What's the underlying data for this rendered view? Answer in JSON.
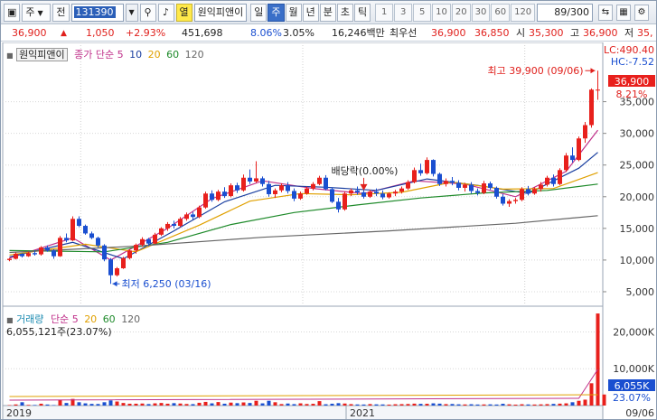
{
  "toolbar": {
    "market": "주",
    "prefix": "전",
    "code": "131390",
    "period_active": "주",
    "periods": [
      "일",
      "주",
      "월",
      "년",
      "분",
      "초",
      "틱"
    ],
    "intervals": [
      "1",
      "3",
      "5",
      "10",
      "20",
      "30",
      "60",
      "120"
    ],
    "stock_name": "원익피앤이",
    "tag": "열",
    "count": "89/300"
  },
  "quote": {
    "price": "36,900",
    "change": "1,050",
    "change_pct": "+2.93%",
    "volume": "451,698",
    "vol_rate": "8.06%",
    "turnover": "3.05%",
    "amount": "16,246백만",
    "best_label": "최우선",
    "best_ask": "36,900",
    "best_bid": "36,850",
    "open_label": "시",
    "open": "35,300",
    "high_label": "고",
    "high": "36,900",
    "low_label": "저",
    "low": "35,"
  },
  "price_legend": {
    "name": "원익피앤이",
    "ma_label": "종가 단순",
    "periods": [
      "5",
      "10",
      "20",
      "60",
      "120"
    ],
    "colors": [
      "#c0308a",
      "#1a3fa0",
      "#e0a000",
      "#1e8a2a",
      "#666666"
    ]
  },
  "volume_legend": {
    "name": "거래량",
    "ma_label": "단순",
    "periods": [
      "5",
      "20",
      "60",
      "120"
    ],
    "info": "6,055,121주(23.07%)"
  },
  "annotations": {
    "high": "최고 39,900 (09/06)",
    "low": "최저 6,250 (03/16)",
    "dividend": "배당락(0.00%)",
    "lc": "LC:490.40",
    "hc": "HC:-7.52",
    "last_price": "36,900",
    "last_pct": "8.21%",
    "last_vol": "6,055K",
    "last_vol_pct": "23.07%"
  },
  "x_axis": [
    "2019",
    "2021",
    "09/06"
  ],
  "chart_data": {
    "type": "candlestick",
    "price_axis": {
      "ticks": [
        5000,
        10000,
        15000,
        20000,
        25000,
        30000,
        35000
      ],
      "labels": [
        "5,000",
        "10,000",
        "15,000",
        "20,000",
        "25,000",
        "30,000",
        "35,000"
      ],
      "ylim": [
        3000,
        41500
      ]
    },
    "volume_axis": {
      "ticks": [
        10000,
        20000
      ],
      "labels": [
        "10,000K",
        "20,000K"
      ],
      "ylim": [
        0,
        26000
      ]
    },
    "candles": [
      [
        0,
        10000,
        10300,
        9800,
        10200
      ],
      [
        1,
        10200,
        11200,
        10100,
        11000
      ],
      [
        2,
        11000,
        11100,
        10400,
        10600
      ],
      [
        3,
        10600,
        11300,
        10500,
        11100
      ],
      [
        4,
        11100,
        11500,
        10700,
        10900
      ],
      [
        5,
        10900,
        12200,
        10700,
        12000
      ],
      [
        6,
        12000,
        12300,
        11300,
        11500
      ],
      [
        7,
        11500,
        11700,
        10200,
        10600
      ],
      [
        8,
        10600,
        13800,
        10500,
        13500
      ],
      [
        9,
        13500,
        14200,
        12800,
        13100
      ],
      [
        10,
        13100,
        16900,
        13000,
        16500
      ],
      [
        11,
        16500,
        16900,
        15200,
        15400
      ],
      [
        12,
        15400,
        15600,
        14000,
        14200
      ],
      [
        13,
        14200,
        14500,
        13300,
        13500
      ],
      [
        14,
        13500,
        13700,
        12000,
        12300
      ],
      [
        15,
        12300,
        12500,
        9800,
        10100
      ],
      [
        16,
        10100,
        10300,
        6250,
        7600
      ],
      [
        17,
        7600,
        8900,
        7400,
        8700
      ],
      [
        18,
        8700,
        10500,
        8600,
        10300
      ],
      [
        19,
        10300,
        11700,
        10100,
        11500
      ],
      [
        20,
        11500,
        12600,
        11000,
        12400
      ],
      [
        21,
        12400,
        13600,
        12100,
        13300
      ],
      [
        22,
        13300,
        13500,
        12200,
        12600
      ],
      [
        23,
        12600,
        14300,
        12500,
        14000
      ],
      [
        24,
        14000,
        15200,
        13800,
        15000
      ],
      [
        25,
        15000,
        16000,
        14600,
        15700
      ],
      [
        26,
        15700,
        16200,
        15000,
        15400
      ],
      [
        27,
        15400,
        16800,
        15200,
        16500
      ],
      [
        28,
        16500,
        17500,
        16200,
        17200
      ],
      [
        29,
        17200,
        17600,
        16400,
        16800
      ],
      [
        30,
        16800,
        18600,
        16600,
        18300
      ],
      [
        31,
        18300,
        20800,
        18100,
        20500
      ],
      [
        32,
        20500,
        21000,
        19200,
        19500
      ],
      [
        33,
        19500,
        21100,
        19300,
        20800
      ],
      [
        34,
        20800,
        21500,
        19800,
        20100
      ],
      [
        35,
        20100,
        22100,
        19900,
        21800
      ],
      [
        36,
        21800,
        22200,
        20600,
        21000
      ],
      [
        37,
        21000,
        23500,
        20800,
        23000
      ],
      [
        38,
        23000,
        24300,
        22000,
        22400
      ],
      [
        39,
        22400,
        25600,
        22200,
        22900
      ],
      [
        40,
        22900,
        23200,
        21600,
        22000
      ],
      [
        41,
        22000,
        22500,
        20000,
        20400
      ],
      [
        42,
        20400,
        21300,
        19800,
        21000
      ],
      [
        43,
        21000,
        22100,
        20700,
        21800
      ],
      [
        44,
        21800,
        22300,
        20500,
        20900
      ],
      [
        45,
        20900,
        21300,
        19300,
        19700
      ],
      [
        46,
        19700,
        20800,
        19500,
        20500
      ],
      [
        47,
        20500,
        21600,
        20300,
        21300
      ],
      [
        48,
        21300,
        22300,
        21000,
        22000
      ],
      [
        49,
        22000,
        23300,
        21800,
        23000
      ],
      [
        50,
        23000,
        23400,
        21000,
        21200
      ],
      [
        51,
        21200,
        21500,
        19000,
        19200
      ],
      [
        52,
        19200,
        19800,
        17500,
        18000
      ],
      [
        53,
        18000,
        20800,
        17800,
        20500
      ],
      [
        54,
        20500,
        21300,
        20100,
        21000
      ],
      [
        55,
        21000,
        21600,
        20300,
        20700
      ],
      [
        56,
        20700,
        21100,
        19700,
        20000
      ],
      [
        57,
        20000,
        21100,
        19800,
        20800
      ],
      [
        58,
        20800,
        21300,
        20100,
        20500
      ],
      [
        59,
        20500,
        21000,
        19600,
        19900
      ],
      [
        60,
        19900,
        20700,
        19700,
        20500
      ],
      [
        61,
        20500,
        21100,
        20100,
        20800
      ],
      [
        62,
        20800,
        21600,
        20500,
        21300
      ],
      [
        63,
        21300,
        22600,
        21100,
        22300
      ],
      [
        64,
        22300,
        24600,
        22100,
        24200
      ],
      [
        65,
        24200,
        25200,
        23300,
        23700
      ],
      [
        66,
        23700,
        26200,
        23500,
        25800
      ],
      [
        67,
        25800,
        25900,
        23200,
        23600
      ],
      [
        68,
        23600,
        23800,
        21700,
        22000
      ],
      [
        69,
        22000,
        22900,
        21600,
        22500
      ],
      [
        70,
        22500,
        23100,
        21800,
        22200
      ],
      [
        71,
        22200,
        22600,
        21000,
        21400
      ],
      [
        72,
        21400,
        22200,
        20800,
        21900
      ],
      [
        73,
        21900,
        22300,
        20500,
        20900
      ],
      [
        74,
        20900,
        21300,
        20200,
        20600
      ],
      [
        75,
        20600,
        22500,
        20400,
        22100
      ],
      [
        76,
        22100,
        22400,
        21100,
        21400
      ],
      [
        77,
        21400,
        21600,
        19700,
        20000
      ],
      [
        78,
        20000,
        20400,
        18600,
        18900
      ],
      [
        79,
        18900,
        19600,
        18400,
        19300
      ],
      [
        80,
        19300,
        19800,
        18900,
        19500
      ],
      [
        81,
        19500,
        21500,
        19300,
        21200
      ],
      [
        82,
        21200,
        21700,
        20200,
        20500
      ],
      [
        83,
        20500,
        21500,
        20300,
        21200
      ],
      [
        84,
        21200,
        22300,
        20800,
        21900
      ],
      [
        85,
        21900,
        23300,
        21600,
        23000
      ],
      [
        86,
        23000,
        23500,
        21600,
        22000
      ],
      [
        87,
        22000,
        24500,
        21800,
        24200
      ],
      [
        88,
        24200,
        26900,
        23900,
        26500
      ],
      [
        89,
        26500,
        27800,
        25400,
        25800
      ],
      [
        90,
        25800,
        29500,
        25600,
        29200
      ],
      [
        91,
        29200,
        31800,
        28500,
        31300
      ],
      [
        92,
        31300,
        37100,
        30900,
        36900
      ],
      [
        93,
        36900,
        39900,
        35300,
        36900
      ]
    ],
    "volume": [
      120,
      300,
      900,
      180,
      150,
      500,
      280,
      120,
      1500,
      700,
      1800,
      900,
      600,
      450,
      420,
      900,
      1400,
      1100,
      700,
      500,
      500,
      550,
      400,
      600,
      700,
      500,
      650,
      550,
      420,
      380,
      750,
      1000,
      600,
      950,
      500,
      800,
      650,
      850,
      700,
      1300,
      600,
      1300,
      900,
      400,
      550,
      380,
      600,
      420,
      480,
      1200,
      350,
      500,
      650,
      550,
      380,
      300,
      280,
      400,
      320,
      300,
      260,
      350,
      380,
      420,
      520,
      460,
      480,
      600,
      520,
      380,
      420,
      330,
      300,
      350,
      280,
      300,
      320,
      280,
      480,
      330,
      250,
      350,
      300,
      280,
      320,
      380,
      450,
      520,
      600,
      900,
      1300,
      1600,
      6055,
      25000,
      3000
    ],
    "ma": {
      "5": {
        "color": "#c0308a",
        "points": [
          [
            0,
            10300
          ],
          [
            10,
            13500
          ],
          [
            16,
            10000
          ],
          [
            25,
            15000
          ],
          [
            32,
            19700
          ],
          [
            40,
            22500
          ],
          [
            48,
            21300
          ],
          [
            56,
            20500
          ],
          [
            64,
            22500
          ],
          [
            72,
            22000
          ],
          [
            80,
            20000
          ],
          [
            88,
            24000
          ],
          [
            93,
            30500
          ]
        ]
      },
      "10": {
        "color": "#1a3fa0",
        "points": [
          [
            0,
            10500
          ],
          [
            10,
            12800
          ],
          [
            18,
            10200
          ],
          [
            26,
            14600
          ],
          [
            34,
            19200
          ],
          [
            42,
            21800
          ],
          [
            50,
            21500
          ],
          [
            58,
            21000
          ],
          [
            66,
            22800
          ],
          [
            74,
            21800
          ],
          [
            82,
            20500
          ],
          [
            90,
            24500
          ],
          [
            93,
            27000
          ]
        ]
      },
      "20": {
        "color": "#e0a000",
        "points": [
          [
            0,
            10800
          ],
          [
            12,
            12500
          ],
          [
            20,
            11300
          ],
          [
            30,
            15500
          ],
          [
            38,
            19300
          ],
          [
            46,
            20500
          ],
          [
            54,
            20300
          ],
          [
            62,
            20700
          ],
          [
            70,
            22300
          ],
          [
            78,
            21200
          ],
          [
            86,
            21300
          ],
          [
            93,
            23800
          ]
        ]
      },
      "60": {
        "color": "#1e8a2a",
        "points": [
          [
            0,
            11500
          ],
          [
            15,
            11300
          ],
          [
            25,
            12800
          ],
          [
            35,
            15600
          ],
          [
            45,
            17500
          ],
          [
            55,
            18700
          ],
          [
            65,
            19800
          ],
          [
            75,
            20600
          ],
          [
            85,
            21000
          ],
          [
            93,
            22000
          ]
        ]
      },
      "120": {
        "color": "#666666",
        "points": [
          [
            0,
            11200
          ],
          [
            20,
            12200
          ],
          [
            40,
            13600
          ],
          [
            60,
            14600
          ],
          [
            80,
            15800
          ],
          [
            93,
            17000
          ]
        ]
      }
    }
  }
}
